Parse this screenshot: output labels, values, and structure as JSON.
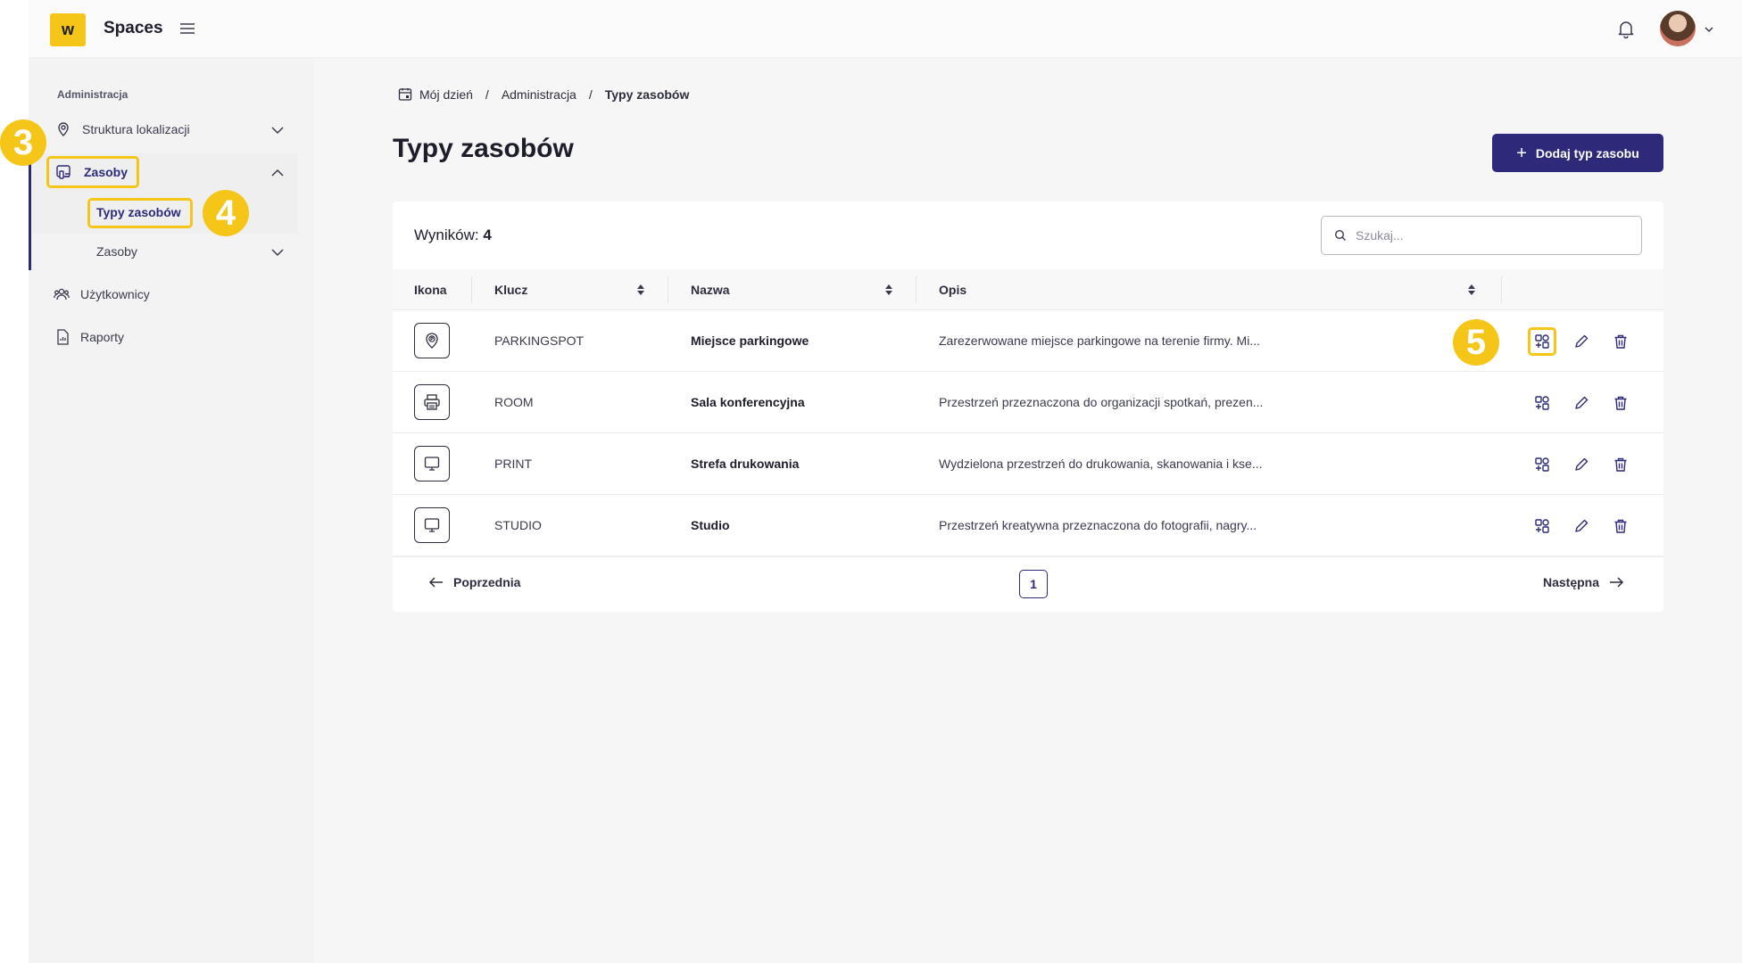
{
  "header": {
    "logo_letter": "w",
    "app_title": "Spaces"
  },
  "sidebar": {
    "section_label": "Administracja",
    "items": [
      {
        "label": "Struktura lokalizacji"
      },
      {
        "label": "Zasoby"
      },
      {
        "label": "Typy zasobów"
      },
      {
        "label": "Zasoby"
      },
      {
        "label": "Użytkownicy"
      },
      {
        "label": "Raporty"
      }
    ]
  },
  "steps": {
    "s3": "3",
    "s4": "4",
    "s5": "5"
  },
  "breadcrumb": {
    "items": [
      "Mój dzień",
      "Administracja",
      "Typy zasobów"
    ],
    "separator": "/"
  },
  "page": {
    "title": "Typy zasobów",
    "add_button": "Dodaj typ zasobu"
  },
  "table": {
    "results_label": "Wyników:",
    "results_count": "4",
    "search_placeholder": "Szukaj...",
    "columns": [
      "Ikona",
      "Klucz",
      "Nazwa",
      "Opis"
    ],
    "rows": [
      {
        "icon": "parking-pin-icon",
        "key": "PARKINGSPOT",
        "name": "Miejsce parkingowe",
        "desc": "Zarezerwowane miejsce parkingowe na terenie firmy. Mi..."
      },
      {
        "icon": "printer-icon",
        "key": "ROOM",
        "name": "Sala konferencyjna",
        "desc": "Przestrzeń przeznaczona do organizacji spotkań, prezen..."
      },
      {
        "icon": "monitor-icon",
        "key": "PRINT",
        "name": "Strefa drukowania",
        "desc": "Wydzielona przestrzeń do drukowania, skanowania i kse..."
      },
      {
        "icon": "monitor-icon",
        "key": "STUDIO",
        "name": "Studio",
        "desc": "Przestrzeń kreatywna przeznaczona do fotografii, nagry..."
      }
    ]
  },
  "pagination": {
    "prev": "Poprzednia",
    "next": "Następna",
    "current_page": "1"
  },
  "colors": {
    "primary": "#2d2a7a",
    "highlight": "#f5c518"
  }
}
